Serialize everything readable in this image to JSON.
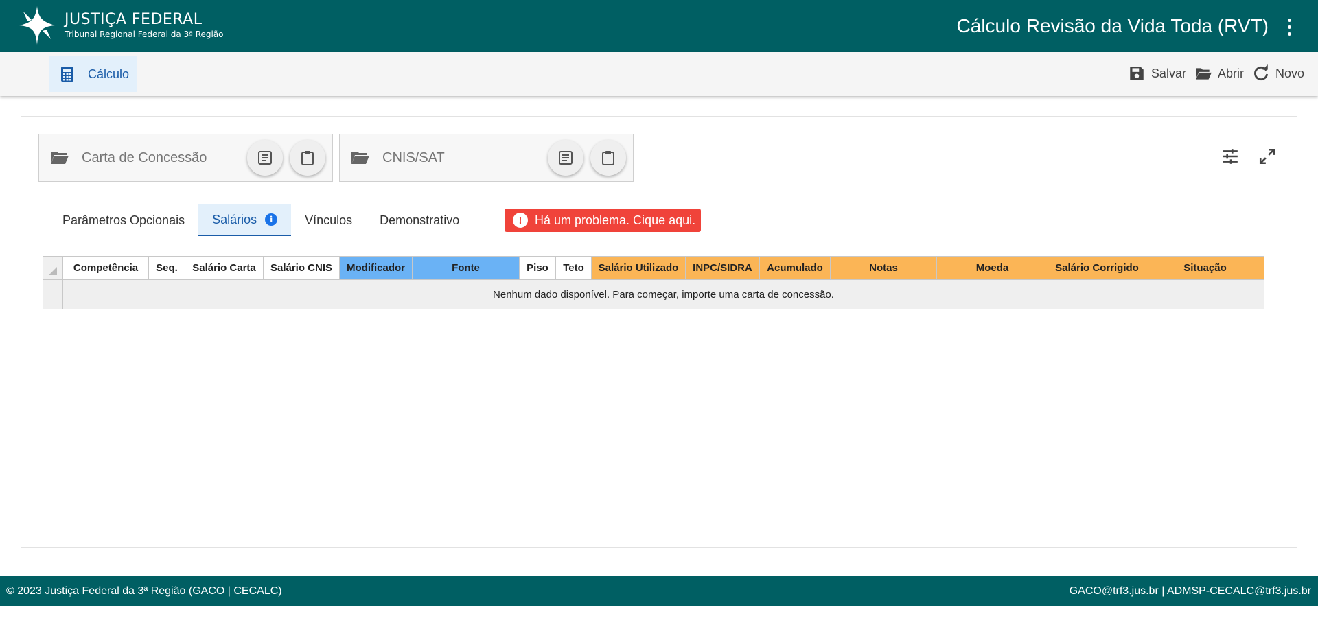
{
  "header": {
    "logo_title": "JUSTIÇA FEDERAL",
    "logo_subtitle": "Tribunal Regional Federal da 3ª Região",
    "app_title": "Cálculo Revisão da Vida Toda (RVT)",
    "brand_color": "#005f63"
  },
  "toolbar": {
    "tab_label": "Cálculo",
    "save_label": "Salvar",
    "open_label": "Abrir",
    "new_label": "Novo"
  },
  "imports": {
    "carta_label": "Carta de Concessão",
    "cnis_label": "CNIS/SAT"
  },
  "tabs": [
    {
      "label": "Parâmetros Opcionais"
    },
    {
      "label": "Salários"
    },
    {
      "label": "Vínculos"
    },
    {
      "label": "Demonstrativo"
    }
  ],
  "alert": {
    "label": "Há um problema. Cique aqui.",
    "icon": "!",
    "color": "#f0433a"
  },
  "table": {
    "columns": [
      {
        "label": "Competência",
        "color": "white"
      },
      {
        "label": "Seq.",
        "color": "white"
      },
      {
        "label": "Salário Carta",
        "color": "white"
      },
      {
        "label": "Salário CNIS",
        "color": "white"
      },
      {
        "label": "Modificador",
        "color": "blue"
      },
      {
        "label": "Fonte",
        "color": "blue"
      },
      {
        "label": "Piso",
        "color": "white"
      },
      {
        "label": "Teto",
        "color": "white"
      },
      {
        "label": "Salário Utilizado",
        "color": "orange"
      },
      {
        "label": "INPC/SIDRA",
        "color": "orange"
      },
      {
        "label": "Acumulado",
        "color": "orange"
      },
      {
        "label": "Notas",
        "color": "orange"
      },
      {
        "label": "Moeda",
        "color": "orange"
      },
      {
        "label": "Salário Corrigido",
        "color": "orange"
      },
      {
        "label": "Situação",
        "color": "orange"
      }
    ],
    "empty_message": "Nenhum dado disponível. Para começar, importe uma carta de concessão."
  },
  "footer": {
    "left": "© 2023 Justiça Federal da 3ª Região (GACO | CECALC)",
    "right": "GACO@trf3.jus.br | ADMSP-CECALC@trf3.jus.br"
  }
}
